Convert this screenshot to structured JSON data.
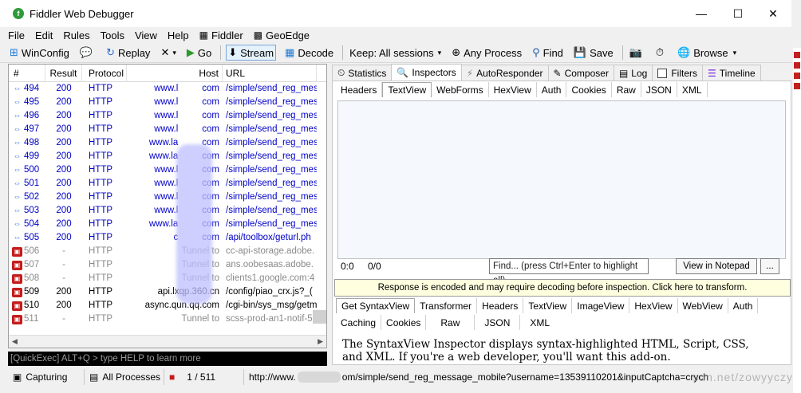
{
  "window": {
    "title": "Fiddler Web Debugger",
    "minimize": "—",
    "maximize": "☐",
    "close": "✕"
  },
  "menu": [
    "File",
    "Edit",
    "Rules",
    "Tools",
    "View",
    "Help",
    "Fiddler",
    "GeoEdge"
  ],
  "toolbar": {
    "winconfig": "WinConfig",
    "replay": "Replay",
    "go": "Go",
    "stream": "Stream",
    "decode": "Decode",
    "keep": "Keep: All sessions",
    "process": "Any Process",
    "find": "Find",
    "save": "Save",
    "browse": "Browse"
  },
  "sessions": {
    "headers": [
      "#",
      "Result",
      "Protocol",
      "Host",
      "URL"
    ],
    "rows": [
      {
        "num": "494",
        "result": "200",
        "protocol": "HTTP",
        "host": "www.l",
        "host2": "com",
        "url": "/simple/send_reg_mes",
        "kind": "ok"
      },
      {
        "num": "495",
        "result": "200",
        "protocol": "HTTP",
        "host": "www.l",
        "host2": "com",
        "url": "/simple/send_reg_mes",
        "kind": "ok"
      },
      {
        "num": "496",
        "result": "200",
        "protocol": "HTTP",
        "host": "www.l",
        "host2": "com",
        "url": "/simple/send_reg_mes",
        "kind": "ok"
      },
      {
        "num": "497",
        "result": "200",
        "protocol": "HTTP",
        "host": "www.l",
        "host2": "com",
        "url": "/simple/send_reg_mes",
        "kind": "ok"
      },
      {
        "num": "498",
        "result": "200",
        "protocol": "HTTP",
        "host": "www.la",
        "host2": "com",
        "url": "/simple/send_reg_mes",
        "kind": "ok"
      },
      {
        "num": "499",
        "result": "200",
        "protocol": "HTTP",
        "host": "www.la",
        "host2": "com",
        "url": "/simple/send_reg_mes",
        "kind": "ok"
      },
      {
        "num": "500",
        "result": "200",
        "protocol": "HTTP",
        "host": "www.l",
        "host2": "com",
        "url": "/simple/send_reg_mes",
        "kind": "ok"
      },
      {
        "num": "501",
        "result": "200",
        "protocol": "HTTP",
        "host": "www.l",
        "host2": "com",
        "url": "/simple/send_reg_mes",
        "kind": "ok"
      },
      {
        "num": "502",
        "result": "200",
        "protocol": "HTTP",
        "host": "www.l",
        "host2": "com",
        "url": "/simple/send_reg_mes",
        "kind": "ok"
      },
      {
        "num": "503",
        "result": "200",
        "protocol": "HTTP",
        "host": "www.l",
        "host2": "com",
        "url": "/simple/send_reg_mes",
        "kind": "ok"
      },
      {
        "num": "504",
        "result": "200",
        "protocol": "HTTP",
        "host": "www.la",
        "host2": "com",
        "url": "/simple/send_reg_mes",
        "kind": "ok"
      },
      {
        "num": "505",
        "result": "200",
        "protocol": "HTTP",
        "host": "c",
        "host2": "com",
        "url": "/api/toolbox/geturl.ph",
        "kind": "ok"
      },
      {
        "num": "506",
        "result": "-",
        "protocol": "HTTP",
        "host": "Tunnel to",
        "host2": "",
        "url": "cc-api-storage.adobe.",
        "kind": "tunnel"
      },
      {
        "num": "507",
        "result": "-",
        "protocol": "HTTP",
        "host": "Tunnel to",
        "host2": "",
        "url": "ans.oobesaas.adobe.",
        "kind": "tunnel"
      },
      {
        "num": "508",
        "result": "-",
        "protocol": "HTTP",
        "host": "Tunnel to",
        "host2": "",
        "url": "clients1.google.com:4",
        "kind": "tunnel"
      },
      {
        "num": "509",
        "result": "200",
        "protocol": "HTTP",
        "host": "api.lxqp.360.cn",
        "host2": "",
        "url": "/config/piao_crx.js?_(",
        "kind": "err"
      },
      {
        "num": "510",
        "result": "200",
        "protocol": "HTTP",
        "host": "async.qun.qq.com",
        "host2": "",
        "url": "/cgi-bin/sys_msg/getm",
        "kind": "err"
      },
      {
        "num": "511",
        "result": "-",
        "protocol": "HTTP",
        "host": "Tunnel to",
        "host2": "",
        "url": "scss-prod-an1-notif-5",
        "kind": "tunnel"
      }
    ]
  },
  "quickexec": "[QuickExec] ALT+Q > type HELP to learn more",
  "status": {
    "capturing": "Capturing",
    "processes": "All Processes",
    "count": "1 / 511",
    "url": "http://www.",
    "url_rest": "om/simple/send_reg_message_mobile?username=13539110201&inputCaptcha=crych"
  },
  "right": {
    "tabs": [
      "Statistics",
      "Inspectors",
      "AutoResponder",
      "Composer",
      "Log",
      "Filters",
      "Timeline"
    ],
    "request_tabs": [
      "Headers",
      "TextView",
      "WebForms",
      "HexView",
      "Auth",
      "Cookies",
      "Raw",
      "JSON",
      "XML"
    ],
    "find": {
      "pos1": "0:0",
      "pos2": "0/0",
      "placeholder": "Find... (press Ctrl+Enter to highlight all)",
      "notepad": "View in Notepad",
      "more": "..."
    },
    "notice": "Response is encoded and may require decoding before inspection. Click here to transform.",
    "response_tabs_row1": [
      "Get SyntaxView",
      "Transformer",
      "Headers",
      "TextView",
      "ImageView",
      "HexView",
      "WebView",
      "Auth"
    ],
    "response_tabs_row2": [
      "Caching",
      "Cookies",
      "Raw",
      "JSON",
      "XML"
    ],
    "response_text_1": "The SyntaxView Inspector displays syntax-highlighted HTML, Script, CSS,",
    "response_text_2": "and XML. If you're a web developer, you'll want this add-on."
  },
  "watermark": "sdn.net/zowyyczy"
}
